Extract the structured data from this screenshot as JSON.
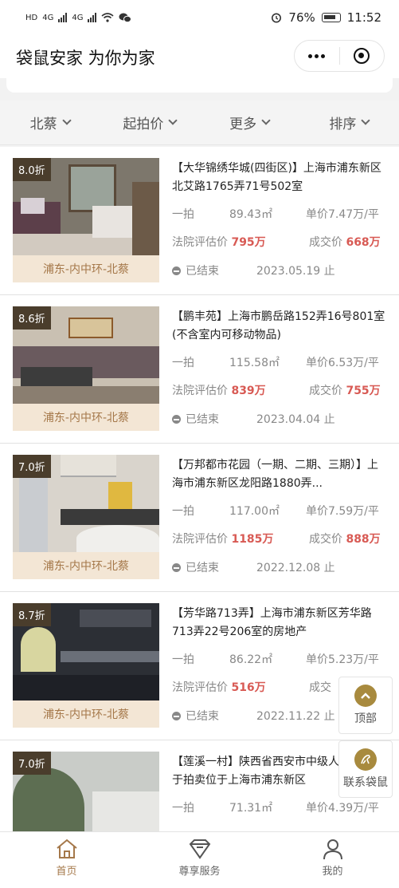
{
  "statusbar": {
    "left_text_1": "HD",
    "left_text_2": "4G",
    "left_text_3": "4G",
    "battery": "76%",
    "time": "11:52"
  },
  "app": {
    "title": "袋鼠安家 为你为家"
  },
  "filters": [
    {
      "label": "北蔡"
    },
    {
      "label": "起拍价"
    },
    {
      "label": "更多"
    },
    {
      "label": "排序"
    }
  ],
  "listings": [
    {
      "discount": "8.0折",
      "location": "浦东-内中环-北蔡",
      "title": "【大华锦绣华城(四街区)】上海市浦东新区北艾路1765弄71号502室",
      "round": "一拍",
      "area": "89.43㎡",
      "unit_price": "单价7.47万/平",
      "appraisal_label": "法院评估价",
      "appraisal": "795万",
      "deal_label": "成交价",
      "deal": "668万",
      "status": "已结束",
      "date": "2023.05.19 止"
    },
    {
      "discount": "8.6折",
      "location": "浦东-内中环-北蔡",
      "title": "【鹏丰苑】上海市鹏岳路152弄16号801室(不含室内可移动物品)",
      "round": "一拍",
      "area": "115.58㎡",
      "unit_price": "单价6.53万/平",
      "appraisal_label": "法院评估价",
      "appraisal": "839万",
      "deal_label": "成交价",
      "deal": "755万",
      "status": "已结束",
      "date": "2023.04.04 止"
    },
    {
      "discount": "7.0折",
      "location": "浦东-内中环-北蔡",
      "title": "【万邦都市花园（一期、二期、三期）】上海市浦东新区龙阳路1880弄...",
      "round": "一拍",
      "area": "117.00㎡",
      "unit_price": "单价7.59万/平",
      "appraisal_label": "法院评估价",
      "appraisal": "1185万",
      "deal_label": "成交价",
      "deal": "888万",
      "status": "已结束",
      "date": "2022.12.08 止"
    },
    {
      "discount": "8.7折",
      "location": "浦东-内中环-北蔡",
      "title": "【芳华路713弄】上海市浦东新区芳华路713弄22号206室的房地产",
      "round": "一拍",
      "area": "86.22㎡",
      "unit_price": "单价5.23万/平",
      "appraisal_label": "法院评估价",
      "appraisal": "516万",
      "deal_label": "成交",
      "deal": "",
      "status": "已结束",
      "date": "2022.11.22 止"
    },
    {
      "discount": "7.0折",
      "location": "",
      "title": "【莲溪一村】陕西省西安市中级人民法院关于拍卖位于上海市浦东新区",
      "round": "一拍",
      "area": "71.31㎡",
      "unit_price": "单价4.39万/平",
      "appraisal_label": "",
      "appraisal": "",
      "deal_label": "",
      "deal": "",
      "status": "",
      "date": ""
    }
  ],
  "float_buttons": {
    "top": "顶部",
    "contact": "联系袋鼠"
  },
  "tabbar": [
    {
      "label": "首页",
      "icon": "home-icon"
    },
    {
      "label": "尊享服务",
      "icon": "diamond-icon"
    },
    {
      "label": "我的",
      "icon": "user-icon"
    }
  ],
  "colors": {
    "accent": "#a5784a",
    "price_red": "#d85a54",
    "discount_bg": "#4a3d2c",
    "location_bg": "#f3e6d5"
  }
}
